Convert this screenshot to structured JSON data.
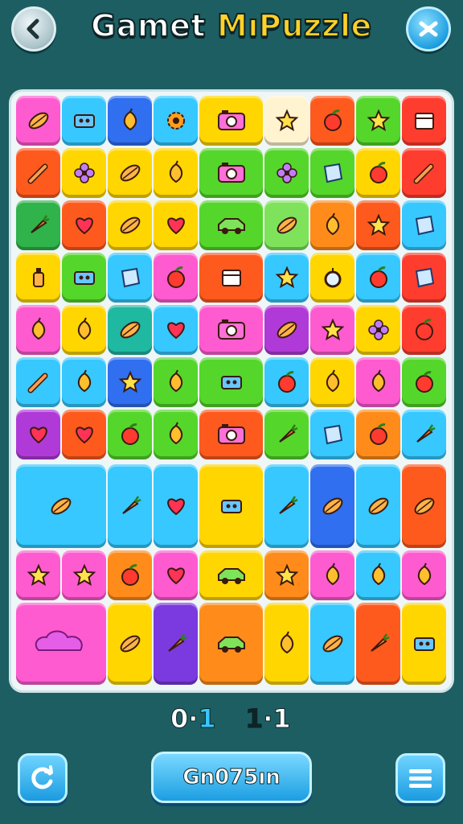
{
  "header": {
    "title_part1": "Gamet",
    "title_part2": "MıPuzzle",
    "back_icon": "back-arrow-icon",
    "settings_icon": "shuffle-settings-icon"
  },
  "colors": {
    "background": "#1d5e63",
    "board": "#eef6f7",
    "title_accent": "#ffd12a",
    "button": "#1c9ee2"
  },
  "board": {
    "tiles": [
      {
        "c": "#ff5bd0",
        "i": "leaf"
      },
      {
        "c": "#36c8ff",
        "i": "machine"
      },
      {
        "c": "#2f6ff0",
        "i": "fruit"
      },
      {
        "c": "#36c8ff",
        "i": "gear"
      },
      {
        "c": "#ffd600",
        "i": "camera"
      },
      {
        "c": "#fff3d0",
        "i": "star"
      },
      {
        "c": "#ff5a1e",
        "i": "apple"
      },
      {
        "c": "#55d62b",
        "i": "star"
      },
      {
        "c": "#ff3d2e",
        "i": "box"
      },
      {
        "c": "#ff5a1e",
        "i": "tool"
      },
      {
        "c": "#ffd600",
        "i": "flower"
      },
      {
        "c": "#ffd600",
        "i": "leaf"
      },
      {
        "c": "#ffd600",
        "i": "fruit"
      },
      {
        "c": "#55d62b",
        "i": "camera"
      },
      {
        "c": "#55d62b",
        "i": "flower"
      },
      {
        "c": "#55d62b",
        "i": "gem"
      },
      {
        "c": "#ffd600",
        "i": "apple"
      },
      {
        "c": "#ff3d2e",
        "i": "tool"
      },
      {
        "c": "#2fb34a",
        "i": "carrot"
      },
      {
        "c": "#ff5a1e",
        "i": "heart"
      },
      {
        "c": "#ffd600",
        "i": "leaf"
      },
      {
        "c": "#ffd600",
        "i": "heart"
      },
      {
        "c": "#55d62b",
        "i": "car"
      },
      {
        "c": "#7ee35a",
        "i": "leaf"
      },
      {
        "c": "#ff8c1a",
        "i": "fruit"
      },
      {
        "c": "#ff5a1e",
        "i": "star"
      },
      {
        "c": "#36c8ff",
        "i": "gem"
      },
      {
        "c": "#ffd600",
        "i": "bottle"
      },
      {
        "c": "#55d62b",
        "i": "machine"
      },
      {
        "c": "#36c8ff",
        "i": "gem"
      },
      {
        "c": "#ff5bd0",
        "i": "apple"
      },
      {
        "c": "#ff5a1e",
        "i": "box"
      },
      {
        "c": "#36c8ff",
        "i": "star"
      },
      {
        "c": "#ffd600",
        "i": "ring"
      },
      {
        "c": "#36c8ff",
        "i": "apple"
      },
      {
        "c": "#ff3d2e",
        "i": "gem"
      },
      {
        "c": "#ff5bd0",
        "i": "fruit"
      },
      {
        "c": "#ffd600",
        "i": "fruit"
      },
      {
        "c": "#1fb8a0",
        "i": "leaf"
      },
      {
        "c": "#36c8ff",
        "i": "heart"
      },
      {
        "c": "#ff5bd0",
        "i": "camera"
      },
      {
        "c": "#b03ad8",
        "i": "leaf"
      },
      {
        "c": "#ff5bd0",
        "i": "star"
      },
      {
        "c": "#ffd600",
        "i": "flower"
      },
      {
        "c": "#ff3d2e",
        "i": "apple"
      },
      {
        "c": "#36c8ff",
        "i": "tool"
      },
      {
        "c": "#36c8ff",
        "i": "fruit"
      },
      {
        "c": "#2f6ff0",
        "i": "star"
      },
      {
        "c": "#55d62b",
        "i": "fruit"
      },
      {
        "c": "#55d62b",
        "i": "machine"
      },
      {
        "c": "#36c8ff",
        "i": "apple"
      },
      {
        "c": "#ffd600",
        "i": "fruit"
      },
      {
        "c": "#ff5bd0",
        "i": "fruit"
      },
      {
        "c": "#55d62b",
        "i": "apple"
      },
      {
        "c": "#b03ad8",
        "i": "heart"
      },
      {
        "c": "#ff5a1e",
        "i": "heart"
      },
      {
        "c": "#55d62b",
        "i": "apple"
      },
      {
        "c": "#55d62b",
        "i": "fruit"
      },
      {
        "c": "#ff5a1e",
        "i": "camera"
      },
      {
        "c": "#55d62b",
        "i": "carrot"
      },
      {
        "c": "#36c8ff",
        "i": "gem"
      },
      {
        "c": "#ff8c1a",
        "i": "apple"
      },
      {
        "c": "#36c8ff",
        "i": "carrot"
      },
      {
        "c": "#36c8ff",
        "i": "leaf"
      },
      {
        "c": "#36c8ff",
        "i": "carrot"
      },
      {
        "c": "#36c8ff",
        "i": "heart"
      },
      {
        "c": "#ffd600",
        "i": "machine"
      },
      {
        "c": "#36c8ff",
        "i": "carrot"
      },
      {
        "c": "#2f6ff0",
        "i": "leaf"
      },
      {
        "c": "#36c8ff",
        "i": "leaf"
      },
      {
        "c": "#ff5a1e",
        "i": "leaf"
      },
      {
        "c": "#ff5bd0",
        "i": "star"
      },
      {
        "c": "#ff5bd0",
        "i": "star"
      },
      {
        "c": "#ff8c1a",
        "i": "apple"
      },
      {
        "c": "#ff5bd0",
        "i": "heart"
      },
      {
        "c": "#ffd600",
        "i": "car"
      },
      {
        "c": "#ff8c1a",
        "i": "star"
      },
      {
        "c": "#ff5bd0",
        "i": "fruit"
      },
      {
        "c": "#36c8ff",
        "i": "fruit"
      },
      {
        "c": "#ff5bd0",
        "i": "fruit"
      },
      {
        "c": "#ff5bd0",
        "i": "cloud"
      },
      {
        "c": "#ffd600",
        "i": "leaf"
      },
      {
        "c": "#7a3adf",
        "i": "carrot"
      },
      {
        "c": "#ff8c1a",
        "i": "car"
      },
      {
        "c": "#ffd600",
        "i": "fruit"
      },
      {
        "c": "#36c8ff",
        "i": "leaf"
      },
      {
        "c": "#ff5a1e",
        "i": "carrot"
      },
      {
        "c": "#ffd600",
        "i": "machine"
      }
    ]
  },
  "score": {
    "left_a": "0",
    "left_dot": "·",
    "left_b": "1",
    "right_a": "1",
    "right_dot": "·",
    "right_b": "1"
  },
  "footer": {
    "restart_icon": "restart-icon",
    "main_button_label": "Gn075ın",
    "menu_icon": "menu-icon"
  }
}
